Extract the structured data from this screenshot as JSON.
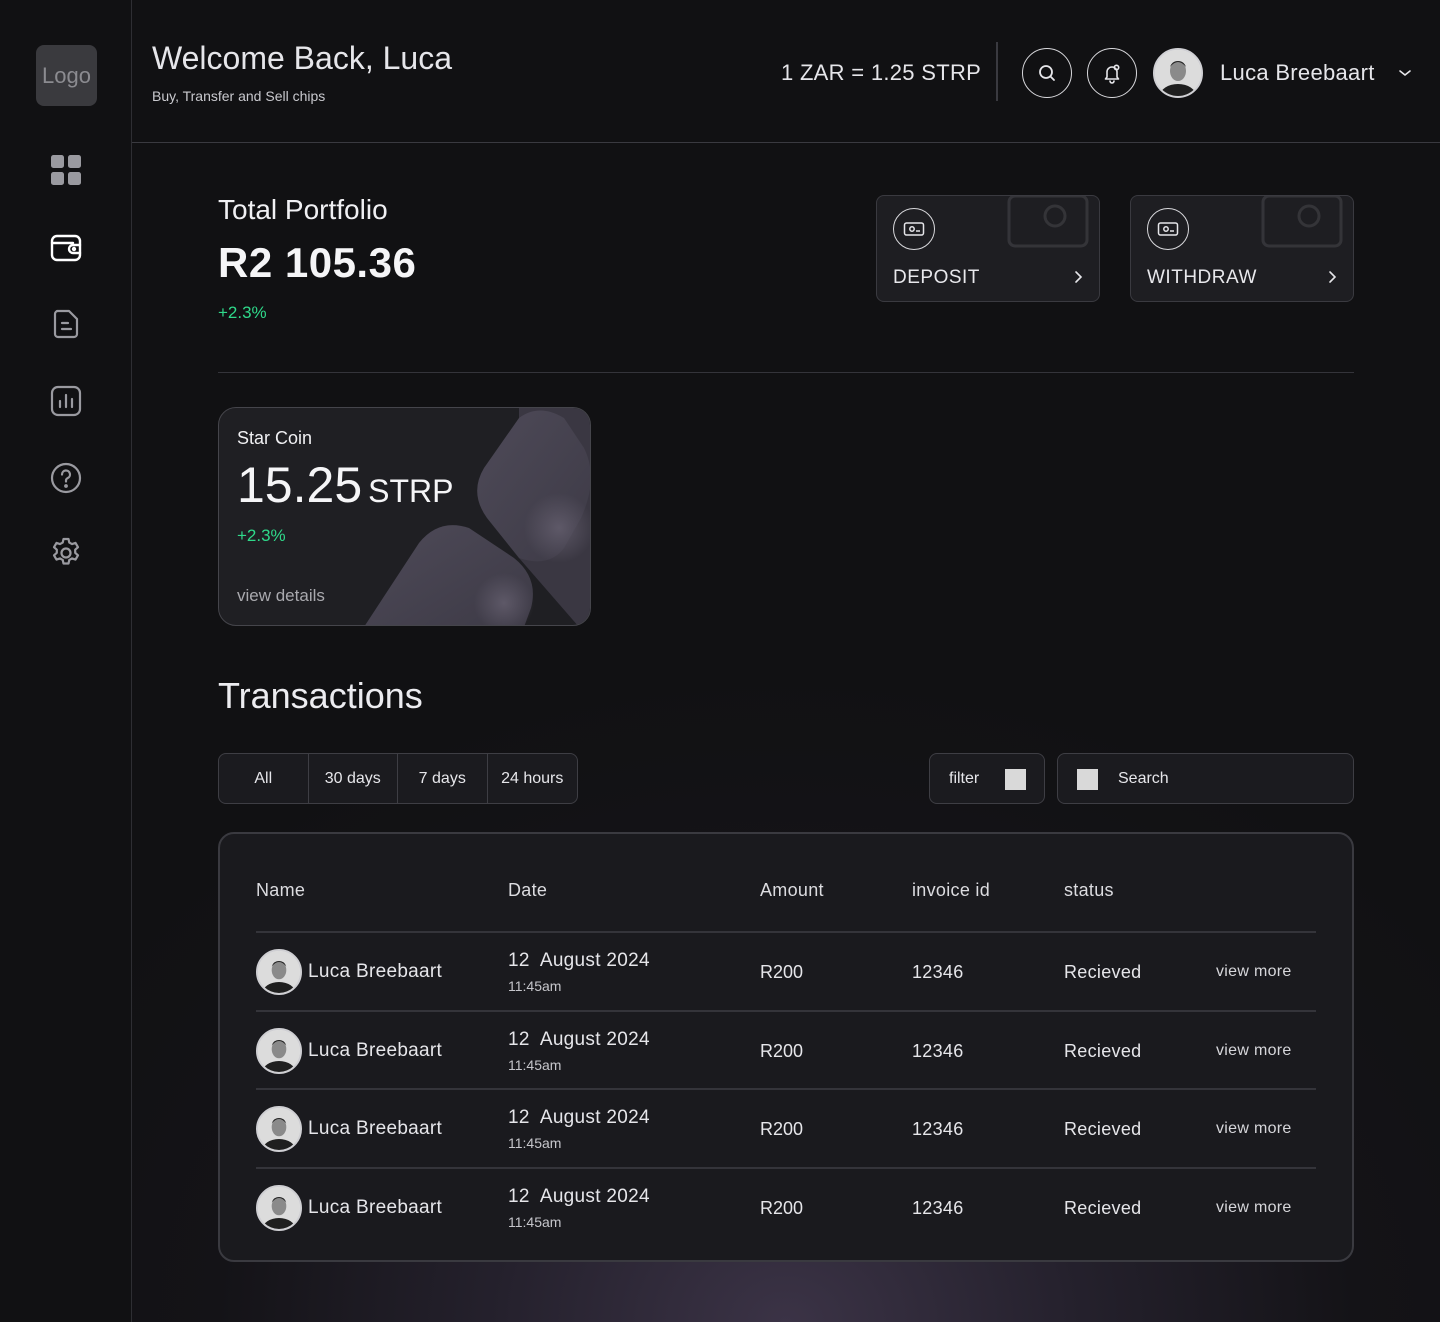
{
  "sidebar": {
    "logo": "Logo",
    "items": [
      {
        "icon": "dashboard-grid-icon"
      },
      {
        "icon": "wallet-icon",
        "active": true
      },
      {
        "icon": "document-icon"
      },
      {
        "icon": "chart-icon"
      },
      {
        "icon": "help-icon"
      },
      {
        "icon": "settings-gear-icon"
      }
    ]
  },
  "header": {
    "title": "Welcome Back, Luca",
    "subtitle": "Buy, Transfer and Sell chips",
    "exchange_rate": "1 ZAR = 1.25 STRP",
    "search_icon": "search-icon",
    "notification_icon": "bell-icon",
    "user_name": "Luca Breebaart"
  },
  "portfolio": {
    "title": "Total Portfolio",
    "value": "R2 105.36",
    "change": "+2.3%"
  },
  "actions": {
    "deposit": "DEPOSIT",
    "withdraw": "WITHDRAW"
  },
  "coin": {
    "name": "Star Coin",
    "amount": "15.25",
    "unit": "STRP",
    "change": "+2.3%",
    "link": "view details"
  },
  "transactions": {
    "title": "Transactions",
    "ranges": [
      "All",
      "30 days",
      "7 days",
      "24 hours"
    ],
    "filter_label": "filter",
    "search_placeholder": "Search",
    "columns": [
      "Name",
      "Date",
      "Amount",
      "invoice id",
      "status"
    ],
    "rows": [
      {
        "name": "Luca Breebaart",
        "date": "12  August 2024",
        "time": "11:45am",
        "amount": "R200",
        "invoice": "12346",
        "status": "Recieved",
        "action": "view more"
      },
      {
        "name": "Luca Breebaart",
        "date": "12  August 2024",
        "time": "11:45am",
        "amount": "R200",
        "invoice": "12346",
        "status": "Recieved",
        "action": "view more"
      },
      {
        "name": "Luca Breebaart",
        "date": "12  August 2024",
        "time": "11:45am",
        "amount": "R200",
        "invoice": "12346",
        "status": "Recieved",
        "action": "view more"
      },
      {
        "name": "Luca Breebaart",
        "date": "12  August 2024",
        "time": "11:45am",
        "amount": "R200",
        "invoice": "12346",
        "status": "Recieved",
        "action": "view more"
      }
    ]
  },
  "colors": {
    "positive": "#2fd98a",
    "background": "#111113",
    "card": "#1e1e22"
  }
}
